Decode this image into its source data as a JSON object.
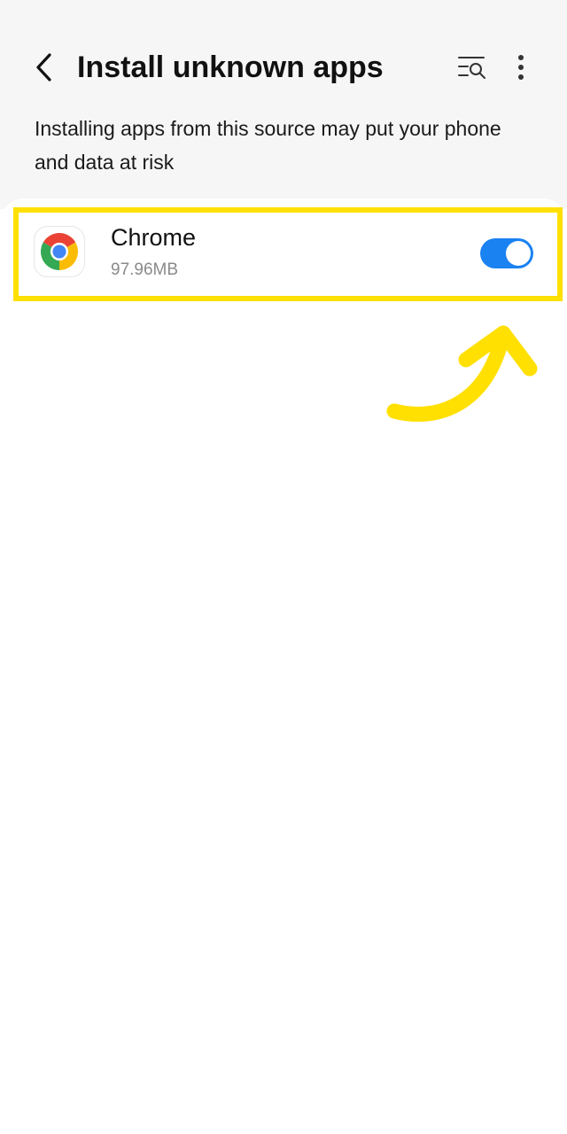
{
  "header": {
    "title": "Install unknown apps",
    "back_icon": "chevron-left-icon",
    "search_icon": "list-search-icon",
    "more_icon": "more-vertical-icon"
  },
  "description": "Installing apps from this source may put your phone and data at risk",
  "apps": [
    {
      "name": "Chrome",
      "size": "97.96MB",
      "icon": "chrome-icon",
      "allowed": true
    }
  ],
  "colors": {
    "toggle_on": "#1a82f1",
    "highlight": "#ffe000",
    "top_background": "#f6f6f6"
  }
}
